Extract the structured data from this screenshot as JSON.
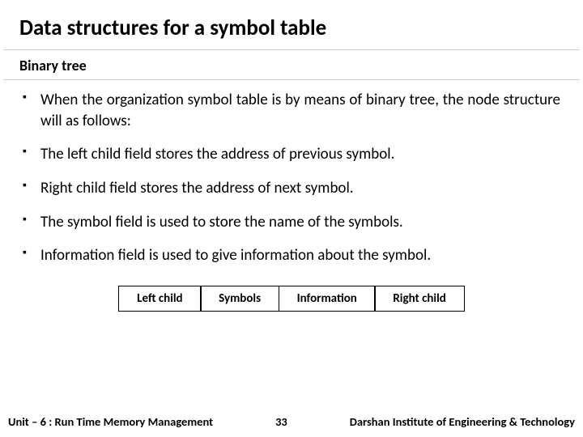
{
  "title": "Data structures for a symbol table",
  "subtitle": "Binary tree",
  "bullets": [
    "When the organization symbol table is by means of binary tree, the node structure will as follows:",
    "The left child field stores the address of previous symbol.",
    "Right child field stores the address of next symbol.",
    "The symbol field is used to store the name of the symbols.",
    "Information field is used to give information about the symbol."
  ],
  "node_fields": [
    "Left child",
    "Symbols",
    "Information",
    "Right child"
  ],
  "footer": {
    "unit": "Unit – 6 : Run Time Memory Management",
    "page": "33",
    "org": "Darshan Institute of Engineering & Technology"
  }
}
